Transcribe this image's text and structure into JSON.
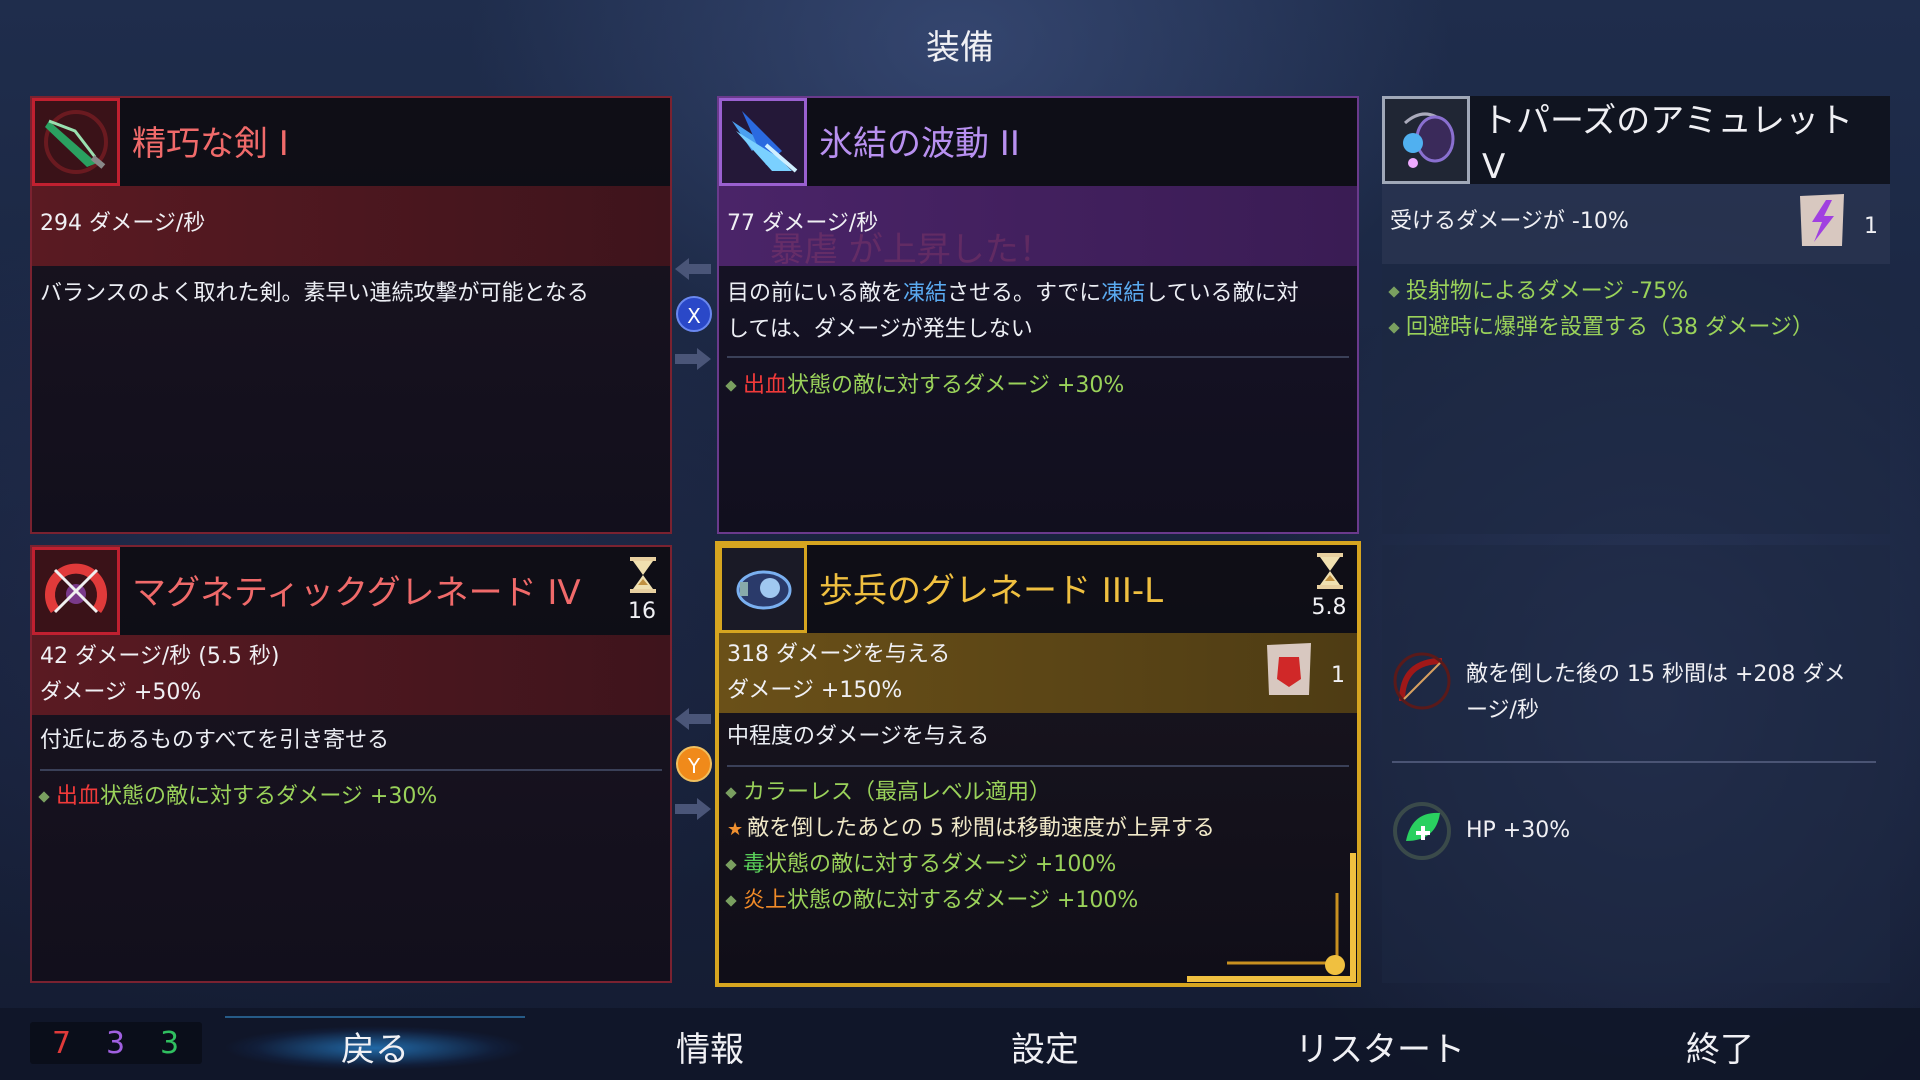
{
  "page_title": "装備",
  "popup_text": "暴虐 が上昇した！",
  "cards": {
    "sword": {
      "title": "精巧な剣 I",
      "stat1": "294 ダメージ/秒",
      "desc": "バランスのよく取れた剣。素早い連続攻撃が可能となる",
      "icon": "sword-icon"
    },
    "frost": {
      "title": "氷結の波動 II",
      "stat1": "77 ダメージ/秒",
      "desc_a": "目の前にいる敵を",
      "desc_b": "凍結",
      "desc_c": "させる。すでに",
      "desc_d": "凍結",
      "desc_e": "している敵に対",
      "desc_f": "しては、ダメージが発生しない",
      "bullet1_red": "出血",
      "bullet1_rest": "状態の敵に対するダメージ +30%",
      "icon": "frost-wave-icon"
    },
    "amulet": {
      "title_line1": "トパーズのアミュレット",
      "title_line2": "V",
      "stat1": "受けるダメージが -10%",
      "scroll_count": "1",
      "bullet1": "投射物によるダメージ -75%",
      "bullet2": "回避時に爆弾を設置する（38 ダメージ）",
      "icon": "amulet-icon"
    },
    "magnetic": {
      "title": "マグネティックグレネード IV",
      "cooldown": "16",
      "stat1": "42 ダメージ/秒 (5.5 秒)",
      "stat2": "ダメージ +50%",
      "desc": "付近にあるものすべてを引き寄せる",
      "bullet1_red": "出血",
      "bullet1_rest": "状態の敵に対するダメージ +30%",
      "icon": "magnetic-grenade-icon"
    },
    "infantry": {
      "title": "歩兵のグレネード III-L",
      "cooldown": "5.8",
      "stat1": "318 ダメージを与える",
      "stat2": "ダメージ +150%",
      "scroll_count": "1",
      "desc": "中程度のダメージを与える",
      "bullet1": "カラーレス（最高レベル適用）",
      "bullet2": "敵を倒したあとの 5 秒間は移動速度が上昇する",
      "bullet3_colored": "毒",
      "bullet3_rest": "状態の敵に対するダメージ +100%",
      "bullet4_colored": "炎上",
      "bullet4_rest": "状態の敵に対するダメージ +100%",
      "icon": "infantry-grenade-icon"
    }
  },
  "swap_keys": {
    "top": "X",
    "bottom": "Y"
  },
  "passives": [
    {
      "text_line1": "敵を倒した後の 15 秒間は +208 ダメ",
      "text_line2": "ージ/秒",
      "icon": "bloody-bow-icon"
    },
    {
      "text_line1": "HP +30%",
      "icon": "health-leaf-icon"
    }
  ],
  "scrolls": {
    "brutality": "7",
    "tactics": "3",
    "survival": "3"
  },
  "colors": {
    "brutality": "#e03a3a",
    "tactics": "#a060e0",
    "survival": "#30c060"
  },
  "menu": {
    "back": "戻る",
    "info": "情報",
    "settings": "設定",
    "restart": "リスタート",
    "quit": "終了"
  }
}
